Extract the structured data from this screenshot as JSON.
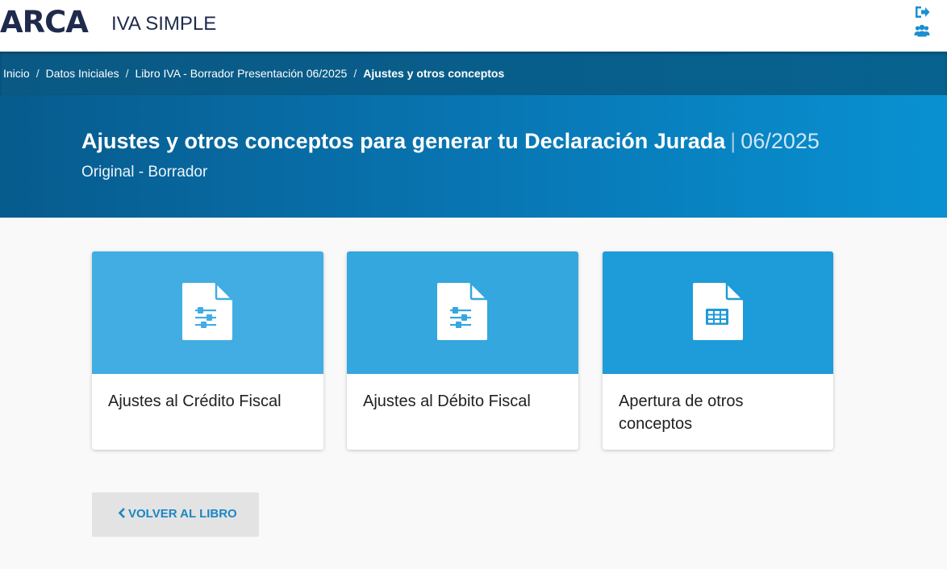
{
  "header": {
    "logo_text": "ARCA",
    "app_name": "IVA SIMPLE",
    "icons": [
      "sign-out-icon",
      "users-icon"
    ]
  },
  "breadcrumb": [
    "Inicio",
    "Datos Iniciales",
    "Libro IVA - Borrador Presentación 06/2025",
    "Ajustes y otros conceptos"
  ],
  "hero": {
    "title": "Ajustes y otros conceptos para generar tu Declaración Jurada",
    "separator": "|",
    "period": "06/2025",
    "subtitle": "Original - Borrador"
  },
  "cards": [
    {
      "label": "Ajustes al Crédito Fiscal",
      "icon": "document-sliders-icon",
      "color": "#42ade2"
    },
    {
      "label": "Ajustes al Débito Fiscal",
      "icon": "document-sliders-icon",
      "color": "#34a7de"
    },
    {
      "label": "Apertura de otros conceptos",
      "icon": "document-table-icon",
      "color": "#1e9bd9"
    }
  ],
  "back_button": {
    "icon": "chevron-left-icon",
    "label": "VOLVER AL LIBRO"
  },
  "colors": {
    "brand_dark": "#1f2a4d",
    "breadcrumb_bg": "#07628f",
    "hero_start": "#075b8d",
    "hero_end": "#0991d2",
    "accent_link": "#1b86c4"
  }
}
